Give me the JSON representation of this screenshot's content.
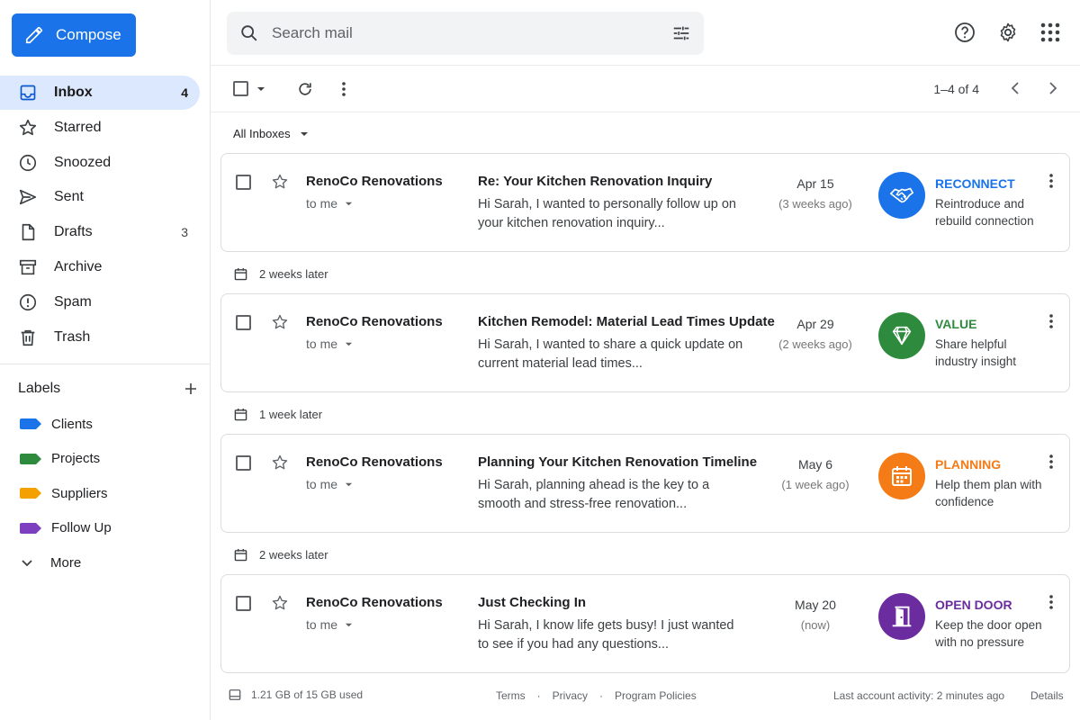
{
  "compose": {
    "label": "Compose",
    "icon": "pencil-icon"
  },
  "nav": [
    {
      "label": "Inbox",
      "count": "4",
      "icon": "inbox-icon"
    },
    {
      "label": "Starred",
      "count": "",
      "icon": "star-icon"
    },
    {
      "label": "Snoozed",
      "count": "",
      "icon": "clock-icon"
    },
    {
      "label": "Sent",
      "count": "",
      "icon": "send-icon"
    },
    {
      "label": "Drafts",
      "count": "3",
      "icon": "file-icon"
    },
    {
      "label": "Archive",
      "count": "",
      "icon": "archive-icon"
    },
    {
      "label": "Spam",
      "count": "",
      "icon": "alert-icon"
    },
    {
      "label": "Trash",
      "count": "",
      "icon": "trash-icon"
    }
  ],
  "labels": {
    "heading": "Labels",
    "items": [
      {
        "label": "Clients",
        "color": "#1a73e8"
      },
      {
        "label": "Projects",
        "color": "#2e8b3e"
      },
      {
        "label": "Suppliers",
        "color": "#f4a100"
      },
      {
        "label": "Follow Up",
        "color": "#7b3fbf"
      }
    ],
    "more": "More"
  },
  "search": {
    "placeholder": "Search mail"
  },
  "toolbar": {
    "pager": "1–4 of 4"
  },
  "filter": {
    "label": "All Inboxes"
  },
  "emails": [
    {
      "sender": "RenoCo Renovations",
      "to": "to me",
      "subject": "Re: Your Kitchen Renovation Inquiry",
      "snippet": "Hi Sarah, I wanted to personally follow up on your kitchen renovation inquiry...",
      "date": "Apr 15",
      "ago": "(3 weeks ago)",
      "tag": "RECONNECT",
      "tag_desc": "Reintroduce and rebuild connection",
      "color": "#1a73e8",
      "icon": "handshake-icon"
    },
    {
      "sender": "RenoCo Renovations",
      "to": "to me",
      "subject": "Kitchen Remodel: Material Lead Times Update",
      "snippet": "Hi Sarah, I wanted to share a quick update on current material lead times...",
      "date": "Apr 29",
      "ago": "(2 weeks ago)",
      "tag": "VALUE",
      "tag_desc": "Share helpful industry insight",
      "color": "#2e8b3e",
      "icon": "diamond-icon"
    },
    {
      "sender": "RenoCo Renovations",
      "to": "to me",
      "subject": "Planning Your Kitchen Renovation Timeline",
      "snippet": "Hi Sarah, planning ahead is the key to a smooth and stress-free renovation...",
      "date": "May 6",
      "ago": "(1 week ago)",
      "tag": "PLANNING",
      "tag_desc": "Help them plan with confidence",
      "color": "#f47b16",
      "icon": "calendar-icon"
    },
    {
      "sender": "RenoCo Renovations",
      "to": "to me",
      "subject": "Just Checking In",
      "snippet": "Hi Sarah, I know life gets busy! I just wanted to see if you had any questions...",
      "date": "May 20",
      "ago": "(now)",
      "tag": "OPEN DOOR",
      "tag_desc": "Keep the door open with no pressure",
      "color": "#6a2c9e",
      "icon": "door-icon"
    }
  ],
  "gaps": [
    "2 weeks later",
    "1 week later",
    "2 weeks later"
  ],
  "footer": {
    "storage": "1.21 GB of 15 GB used",
    "links": [
      "Terms",
      "Privacy",
      "Program Policies"
    ],
    "separator": "·",
    "activity": "Last account activity: 2 minutes ago",
    "details": "Details"
  }
}
